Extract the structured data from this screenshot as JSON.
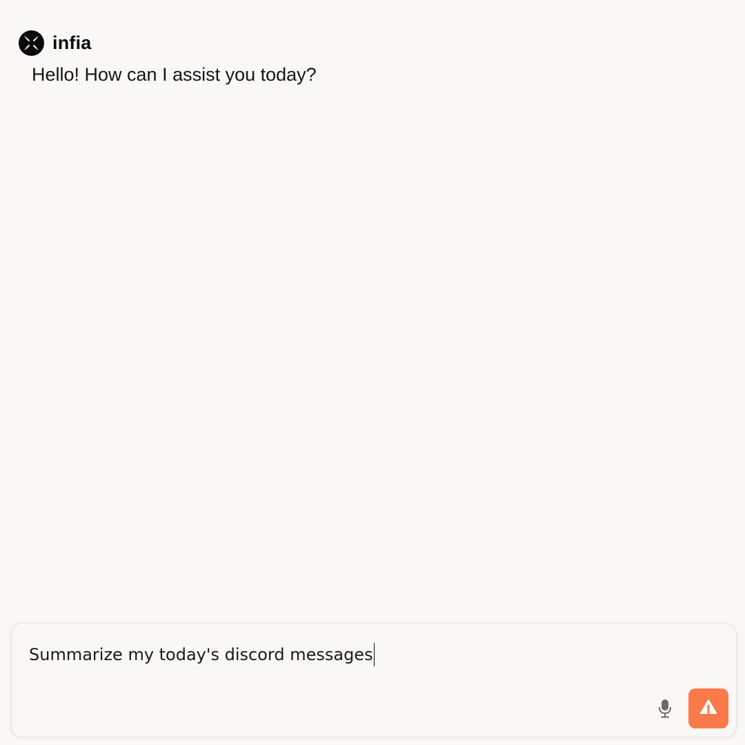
{
  "assistant": {
    "name": "infia",
    "logo_icon": "infia-logo-icon",
    "message": "Hello! How can I assist you today?"
  },
  "composer": {
    "input_value": "Summarize my today's discord messages",
    "mic_icon": "microphone-icon",
    "send_icon": "send-arrow-icon",
    "send_color": "#fa7a4a"
  },
  "colors": {
    "background": "#f9f8f6",
    "accent": "#fa7a4a",
    "text": "#111111"
  }
}
